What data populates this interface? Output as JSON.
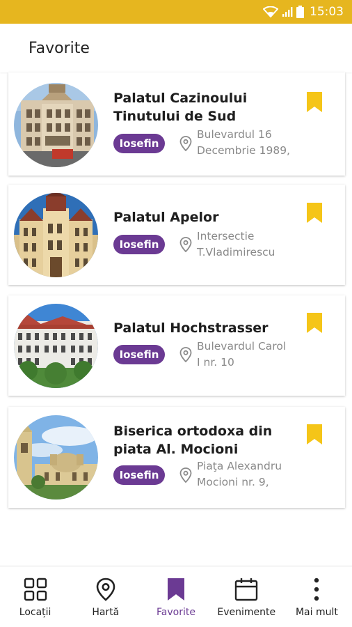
{
  "status_bar": {
    "time": "15:03",
    "icons": [
      "wifi-icon",
      "signal-icon",
      "battery-icon"
    ],
    "color": "#e6b61f"
  },
  "header": {
    "title": "Favorite"
  },
  "colors": {
    "accent": "#6b3a93",
    "bookmark": "#f5c518",
    "status_bar": "#e6b61f"
  },
  "favorites": [
    {
      "title_line1": "Palatul Cazinoului",
      "title_line2": "Tinutului de Sud",
      "badge": "Iosefin",
      "address_line1": "Bulevardul 16",
      "address_line2": "Decembrie 1989,",
      "image": "palace-photo"
    },
    {
      "title_line1": "Palatul Apelor",
      "title_line2": "",
      "badge": "Iosefin",
      "address_line1": "Intersectie",
      "address_line2": "T.Vladimirescu",
      "image": "palace-photo"
    },
    {
      "title_line1": "Palatul Hochstrasser",
      "title_line2": "",
      "badge": "Iosefin",
      "address_line1": "Bulevardul Carol",
      "address_line2": "I nr. 10",
      "image": "palace-photo"
    },
    {
      "title_line1": "Biserica ortodoxa din",
      "title_line2": "piata Al. Mocioni",
      "badge": "Iosefin",
      "address_line1": "Piaţa Alexandru",
      "address_line2": "Mocioni nr. 9,",
      "image": "church-photo"
    }
  ],
  "bottom_nav": {
    "items": [
      {
        "label": "Locații",
        "icon": "grid-icon",
        "active": false
      },
      {
        "label": "Hartă",
        "icon": "map-pin-icon",
        "active": false
      },
      {
        "label": "Favorite",
        "icon": "bookmark-icon",
        "active": true
      },
      {
        "label": "Evenimente",
        "icon": "calendar-icon",
        "active": false
      },
      {
        "label": "Mai mult",
        "icon": "more-vertical-icon",
        "active": false
      }
    ]
  }
}
